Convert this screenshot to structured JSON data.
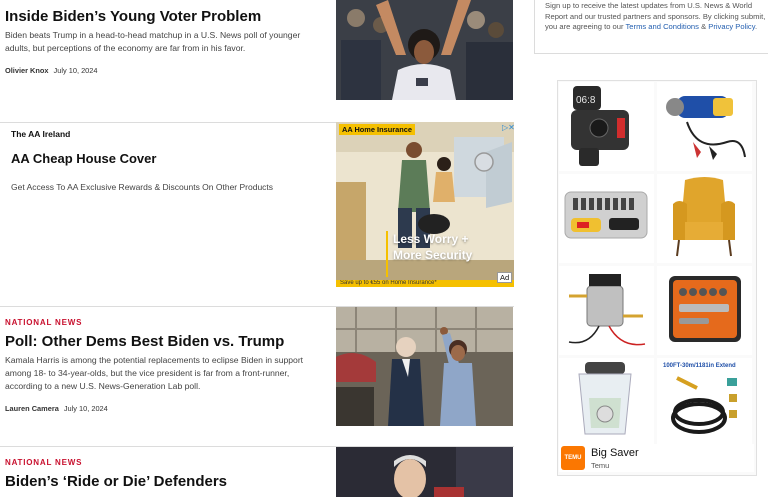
{
  "articles": [
    {
      "headline": "Inside Biden’s Young Voter Problem",
      "summary": "Biden beats Trump in a head-to-head matchup in a U.S. News poll of younger adults, but perceptions of the economy are far from in his favor.",
      "author": "Olivier Knox",
      "date": "July 10, 2024"
    },
    {
      "kicker": "NATIONAL NEWS",
      "headline": "Poll: Other Dems Best Biden vs. Trump",
      "summary": "Kamala Harris is among the potential replacements to eclipse Biden in support among 18- to 34-year-olds, but the vice president is far from a front-runner, according to a new U.S. News-Generation Lab poll.",
      "author": "Lauren Camera",
      "date": "July 10, 2024"
    },
    {
      "kicker": "NATIONAL NEWS",
      "headline": "Biden’s ‘Ride or Die’ Defenders"
    }
  ],
  "sponsored": {
    "sponsor": "The AA Ireland",
    "title": "AA Cheap House Cover",
    "description": "Get Access To AA Exclusive Rewards & Discounts On Other Products",
    "creative": {
      "tag": "AA Home Insurance",
      "line1": "Less Worry +",
      "line2": "More Security",
      "footer": "Save up to €55 on Home Insurance*",
      "ad_label": "Ad"
    }
  },
  "newsletter_legal": {
    "text": "Sign up to receive the latest updates from U.S. News & World Report and our trusted partners and sponsors. By clicking submit, you are agreeing to our",
    "link1": "Terms and Conditions",
    "joiner": " & ",
    "link2": "Privacy Policy",
    "end": "."
  },
  "temu_ad": {
    "title": "Big Saver",
    "subtitle": "Temu",
    "logo": "TEMU",
    "tile_texts": [
      "06:8",
      "100FT-30m/1181in  Extend"
    ]
  },
  "colors": {
    "kicker": "#c8102e",
    "link": "#2560b0",
    "ad_yellow": "#f5c000",
    "temu_orange": "#fb7701"
  }
}
